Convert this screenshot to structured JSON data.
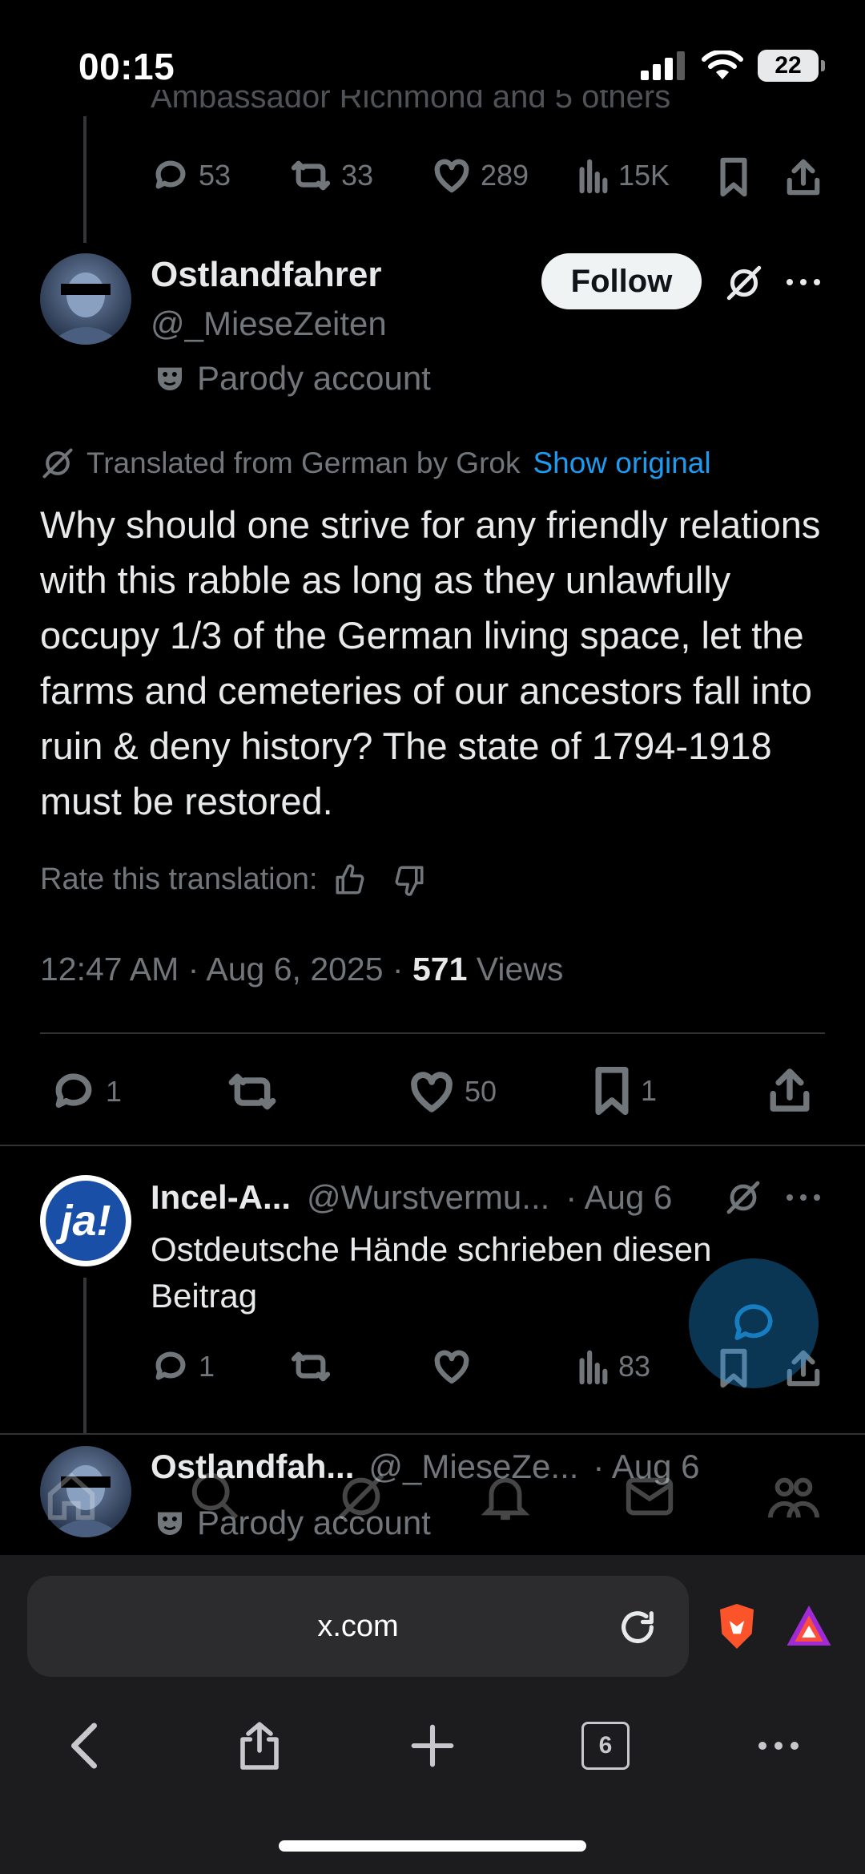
{
  "status": {
    "time": "00:15",
    "battery": "22"
  },
  "prev_tweet": {
    "cut_text": "Ambassador Richmond and 5 others",
    "replies": "53",
    "reposts": "33",
    "likes": "289",
    "views": "15K"
  },
  "main_tweet": {
    "name": "Ostlandfahrer",
    "handle": "@_MieseZeiten",
    "badge": "Parody account",
    "follow_label": "Follow",
    "translated_label": "Translated from German by Grok",
    "show_original": "Show original",
    "text": "Why should one strive for any friendly relations with this rabble as long as they unlawfully occupy 1/3 of the German living space, let the farms and cemeteries of our ancestors fall into ruin & deny history? The state of 1794-1918 must be restored.",
    "rate_label": "Rate this translation:",
    "timestamp": "12:47 AM · Aug 6, 2025 · ",
    "views_count": "571",
    "views_label": " Views",
    "replies": "1",
    "likes": "50",
    "bookmarks": "1"
  },
  "reply_1": {
    "name": "Incel-A...",
    "handle": "@Wurstvermu...",
    "date": "· Aug 6",
    "text": "Ostdeutsche Hände schrieben diesen Beitrag",
    "replies": "1",
    "views": "83",
    "avatar_text": "ja!"
  },
  "reply_2": {
    "name": "Ostlandfah...",
    "handle": "@_MieseZe...",
    "date": "· Aug 6",
    "badge": "Parody account"
  },
  "browser": {
    "url": "x.com",
    "tabs_count": "6"
  },
  "colors": {
    "accent": "#1d9bf0",
    "background": "#000000",
    "muted": "#71767b"
  },
  "icons": [
    "reply-icon",
    "repost-icon",
    "like-icon",
    "views-icon",
    "bookmark-icon",
    "share-icon",
    "grok-icon",
    "more-icon",
    "parody-mask-icon"
  ]
}
